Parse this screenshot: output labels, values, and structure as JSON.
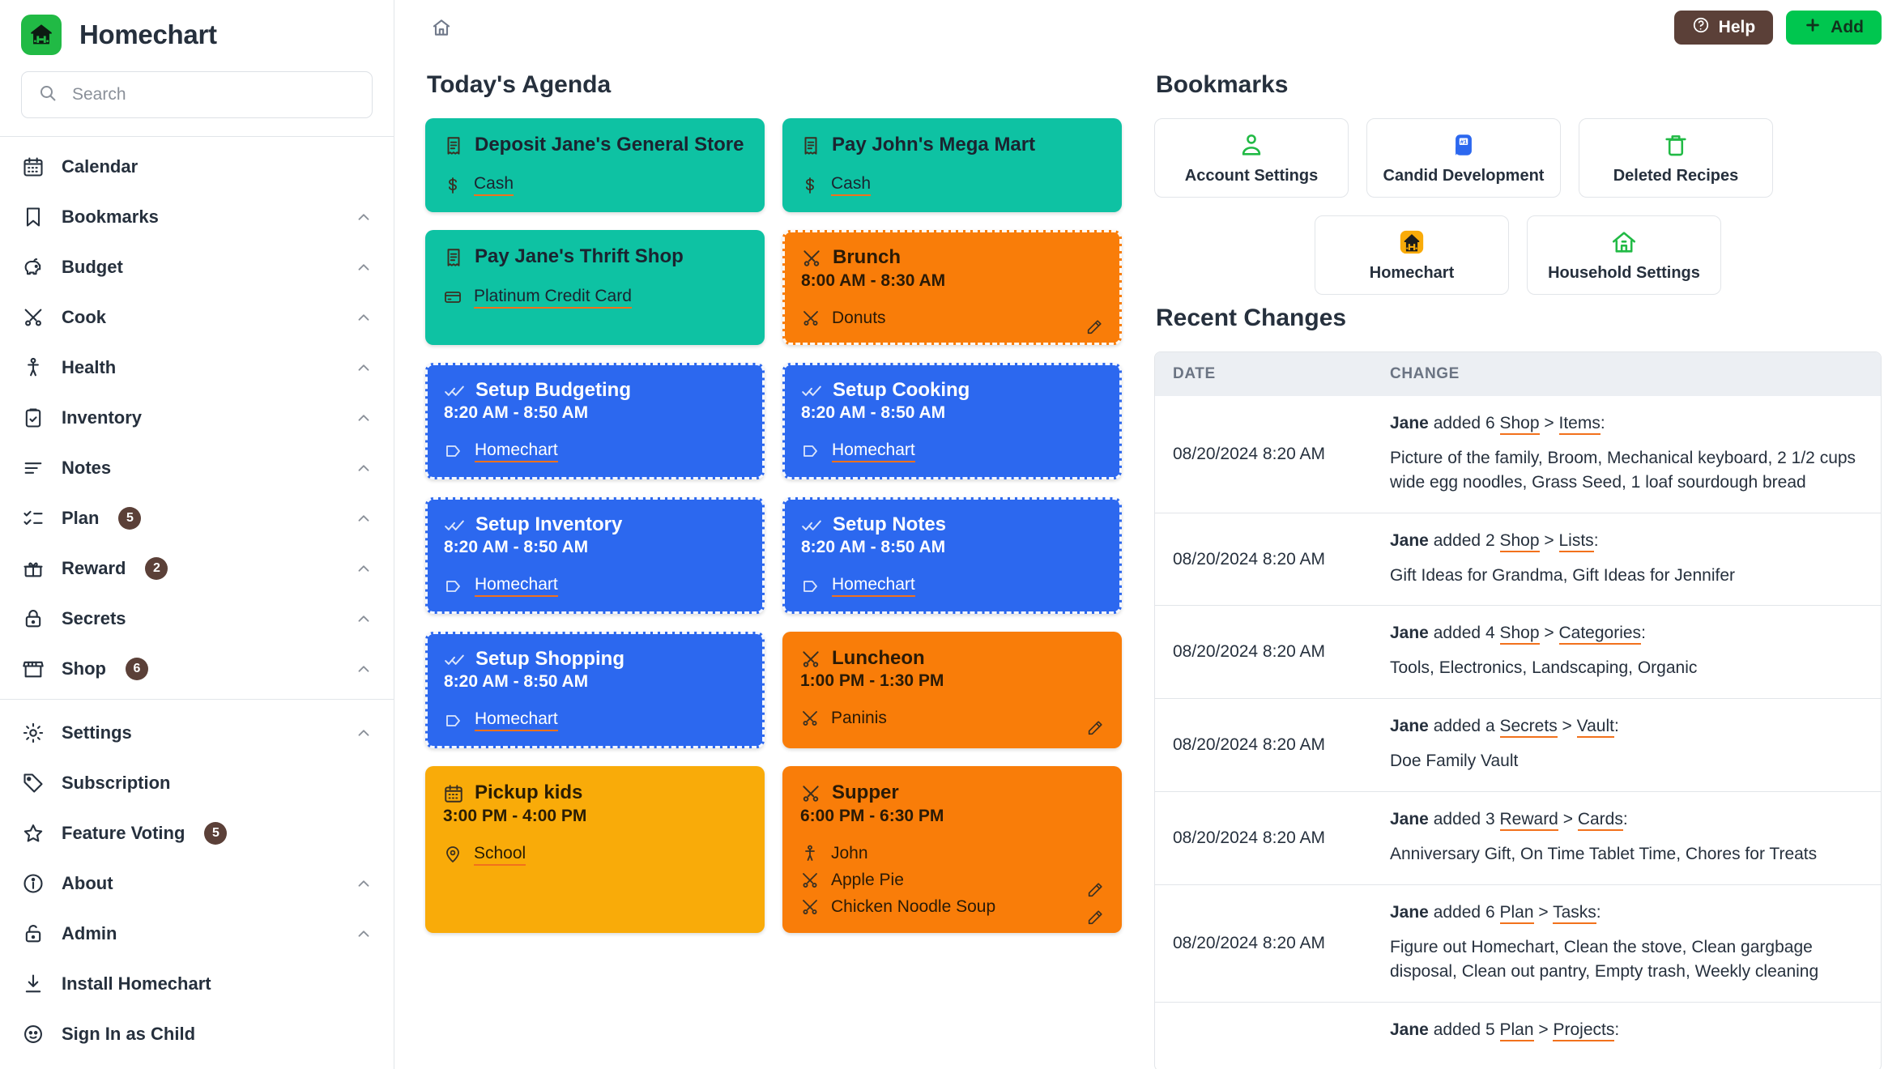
{
  "brand": {
    "name": "Homechart",
    "logo_color": "#21ba45"
  },
  "search": {
    "placeholder": "Search",
    "value": ""
  },
  "sidebar": {
    "primary_items": [
      {
        "label": "Calendar",
        "icon": "calendar-icon",
        "badge": null,
        "chevron": false
      },
      {
        "label": "Bookmarks",
        "icon": "bookmark-icon",
        "badge": null,
        "chevron": true
      },
      {
        "label": "Budget",
        "icon": "piggy-bank-icon",
        "badge": null,
        "chevron": true
      },
      {
        "label": "Cook",
        "icon": "utensils-icon",
        "badge": null,
        "chevron": true
      },
      {
        "label": "Health",
        "icon": "person-icon",
        "badge": null,
        "chevron": true
      },
      {
        "label": "Inventory",
        "icon": "clipboard-check-icon",
        "badge": null,
        "chevron": true
      },
      {
        "label": "Notes",
        "icon": "lines-icon",
        "badge": null,
        "chevron": true
      },
      {
        "label": "Plan",
        "icon": "checklist-icon",
        "badge": "5",
        "chevron": true
      },
      {
        "label": "Reward",
        "icon": "gift-icon",
        "badge": "2",
        "chevron": true
      },
      {
        "label": "Secrets",
        "icon": "lock-icon",
        "badge": null,
        "chevron": true
      },
      {
        "label": "Shop",
        "icon": "store-icon",
        "badge": "6",
        "chevron": true
      }
    ],
    "secondary_items": [
      {
        "label": "Settings",
        "icon": "gear-icon",
        "badge": null,
        "chevron": true
      },
      {
        "label": "Subscription",
        "icon": "tag-icon",
        "badge": null,
        "chevron": false
      },
      {
        "label": "Feature Voting",
        "icon": "star-icon",
        "badge": "5",
        "chevron": false
      },
      {
        "label": "About",
        "icon": "info-icon",
        "badge": null,
        "chevron": true
      },
      {
        "label": "Admin",
        "icon": "unlock-icon",
        "badge": null,
        "chevron": true
      },
      {
        "label": "Install Homechart",
        "icon": "download-icon",
        "badge": null,
        "chevron": false
      },
      {
        "label": "Sign In as Child",
        "icon": "child-face-icon",
        "badge": null,
        "chevron": false
      }
    ],
    "badge_color": "#5b4038"
  },
  "topbar": {
    "home_icon": "home-icon",
    "help_label": "Help",
    "add_label": "Add",
    "help_color": "#5b4038",
    "add_color": "#00c64f"
  },
  "agenda": {
    "title": "Today's Agenda",
    "cards": [
      {
        "theme": "t-teal",
        "dashed": false,
        "icon": "receipt-icon",
        "title": "Deposit Jane's General Store",
        "time": "",
        "rows": [
          {
            "icon": "dollar-icon",
            "text": "Cash",
            "link": true
          }
        ],
        "pencil": false,
        "pencil_rows": []
      },
      {
        "theme": "t-teal",
        "dashed": false,
        "icon": "receipt-icon",
        "title": "Pay John's Mega Mart",
        "time": "",
        "rows": [
          {
            "icon": "dollar-icon",
            "text": "Cash",
            "link": true
          }
        ],
        "pencil": false,
        "pencil_rows": []
      },
      {
        "theme": "t-teal",
        "dashed": false,
        "icon": "receipt-icon",
        "title": "Pay Jane's Thrift Shop",
        "time": "",
        "rows": [
          {
            "icon": "card-icon",
            "text": "Platinum Credit Card",
            "link": true
          }
        ],
        "pencil": false,
        "pencil_rows": []
      },
      {
        "theme": "t-orange",
        "dashed": true,
        "icon": "utensils-icon",
        "title": "Brunch",
        "time": "8:00 AM - 8:30 AM",
        "rows": [
          {
            "icon": "utensils-icon",
            "text": "Donuts",
            "link": false
          }
        ],
        "pencil": true,
        "pencil_rows": [
          0
        ]
      },
      {
        "theme": "t-blue",
        "dashed": true,
        "icon": "double-check-icon",
        "title": "Setup Budgeting",
        "time": "8:20 AM - 8:50 AM",
        "rows": [
          {
            "icon": "tag-outline-icon",
            "text": "Homechart",
            "link": true
          }
        ],
        "pencil": false,
        "pencil_rows": []
      },
      {
        "theme": "t-blue",
        "dashed": true,
        "icon": "double-check-icon",
        "title": "Setup Cooking",
        "time": "8:20 AM - 8:50 AM",
        "rows": [
          {
            "icon": "tag-outline-icon",
            "text": "Homechart",
            "link": true
          }
        ],
        "pencil": false,
        "pencil_rows": []
      },
      {
        "theme": "t-blue",
        "dashed": true,
        "icon": "double-check-icon",
        "title": "Setup Inventory",
        "time": "8:20 AM - 8:50 AM",
        "rows": [
          {
            "icon": "tag-outline-icon",
            "text": "Homechart",
            "link": true
          }
        ],
        "pencil": false,
        "pencil_rows": []
      },
      {
        "theme": "t-blue",
        "dashed": true,
        "icon": "double-check-icon",
        "title": "Setup Notes",
        "time": "8:20 AM - 8:50 AM",
        "rows": [
          {
            "icon": "tag-outline-icon",
            "text": "Homechart",
            "link": true
          }
        ],
        "pencil": false,
        "pencil_rows": []
      },
      {
        "theme": "t-blue",
        "dashed": true,
        "icon": "double-check-icon",
        "title": "Setup Shopping",
        "time": "8:20 AM - 8:50 AM",
        "rows": [
          {
            "icon": "tag-outline-icon",
            "text": "Homechart",
            "link": true
          }
        ],
        "pencil": false,
        "pencil_rows": []
      },
      {
        "theme": "t-orange",
        "dashed": false,
        "icon": "utensils-icon",
        "title": "Luncheon",
        "time": "1:00 PM - 1:30 PM",
        "rows": [
          {
            "icon": "utensils-icon",
            "text": "Paninis",
            "link": false
          }
        ],
        "pencil": true,
        "pencil_rows": [
          0
        ]
      },
      {
        "theme": "t-yellow",
        "dashed": false,
        "icon": "calendar-icon",
        "title": "Pickup kids",
        "time": "3:00 PM - 4:00 PM",
        "rows": [
          {
            "icon": "pin-icon",
            "text": "School",
            "link": true
          }
        ],
        "pencil": false,
        "pencil_rows": []
      },
      {
        "theme": "t-orange",
        "dashed": false,
        "icon": "utensils-icon",
        "title": "Supper",
        "time": "6:00 PM - 6:30 PM",
        "rows": [
          {
            "icon": "person-icon",
            "text": "John",
            "link": false
          },
          {
            "icon": "utensils-icon",
            "text": "Apple Pie",
            "link": false
          },
          {
            "icon": "utensils-icon",
            "text": "Chicken Noodle Soup",
            "link": false
          }
        ],
        "pencil": false,
        "pencil_rows": [
          1,
          2
        ]
      }
    ]
  },
  "bookmarks": {
    "title": "Bookmarks",
    "row1": [
      {
        "label": "Account Settings",
        "icon": "account-icon",
        "color": "#21ba45",
        "tile": false
      },
      {
        "label": "Candid Development",
        "icon": "flag-hash-icon",
        "color": "#2c68ef",
        "tile": true,
        "tile_bg": "#2c68ef"
      },
      {
        "label": "Deleted Recipes",
        "icon": "trash-icon",
        "color": "#21ba45",
        "tile": false
      }
    ],
    "row2": [
      {
        "label": "Homechart",
        "icon": "homechart-logo-icon",
        "color": "#f9ab09",
        "tile": true,
        "tile_bg": "#f9ab09"
      },
      {
        "label": "Household Settings",
        "icon": "house-icon",
        "color": "#21ba45",
        "tile": false
      }
    ]
  },
  "recent_changes": {
    "title": "Recent Changes",
    "columns": [
      "DATE",
      "CHANGE"
    ],
    "rows": [
      {
        "date": "08/20/2024 8:20 AM",
        "prefix": "Jane",
        "verb": "added",
        "count": "6",
        "link_a": "Shop",
        "sep": ">",
        "link_b": "Items",
        "colon": ":",
        "detail": "Picture of the family, Broom, Mechanical keyboard, 2 1/2 cups wide egg noodles, Grass Seed, 1 loaf sourdough bread"
      },
      {
        "date": "08/20/2024 8:20 AM",
        "prefix": "Jane",
        "verb": "added",
        "count": "2",
        "link_a": "Shop",
        "sep": ">",
        "link_b": "Lists",
        "colon": ":",
        "detail": "Gift Ideas for Grandma, Gift Ideas for Jennifer"
      },
      {
        "date": "08/20/2024 8:20 AM",
        "prefix": "Jane",
        "verb": "added",
        "count": "4",
        "link_a": "Shop",
        "sep": ">",
        "link_b": "Categories",
        "colon": ":",
        "detail": "Tools, Electronics, Landscaping, Organic"
      },
      {
        "date": "08/20/2024 8:20 AM",
        "prefix": "Jane",
        "verb": "added",
        "count": "a",
        "link_a": "Secrets",
        "sep": ">",
        "link_b": "Vault",
        "colon": ":",
        "detail": "Doe Family Vault"
      },
      {
        "date": "08/20/2024 8:20 AM",
        "prefix": "Jane",
        "verb": "added",
        "count": "3",
        "link_a": "Reward",
        "sep": ">",
        "link_b": "Cards",
        "colon": ":",
        "detail": "Anniversary Gift, On Time Tablet Time, Chores for Treats"
      },
      {
        "date": "08/20/2024 8:20 AM",
        "prefix": "Jane",
        "verb": "added",
        "count": "6",
        "link_a": "Plan",
        "sep": ">",
        "link_b": "Tasks",
        "colon": ":",
        "detail": "Figure out Homechart, Clean the stove, Clean gargbage disposal, Clean out pantry, Empty trash, Weekly cleaning"
      },
      {
        "date": "",
        "prefix": "Jane",
        "verb": "added",
        "count": "5",
        "link_a": "Plan",
        "sep": ">",
        "link_b": "Projects",
        "colon": ":",
        "detail": ""
      }
    ]
  },
  "colors": {
    "accent_link": "#f2711c",
    "teal": "#0ec2a3",
    "orange": "#f97d09",
    "blue": "#2c68ef",
    "yellow": "#f9ab09"
  }
}
